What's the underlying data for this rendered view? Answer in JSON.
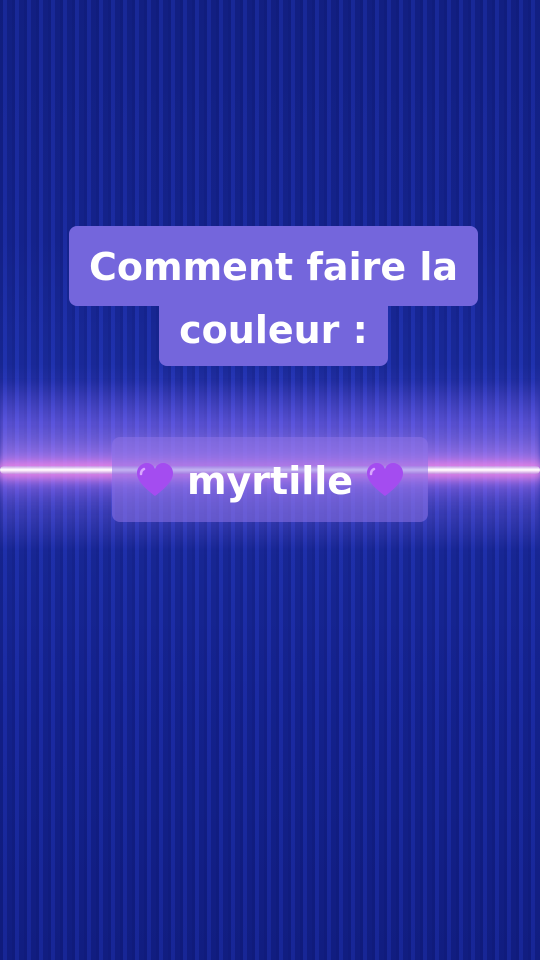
{
  "caption": {
    "line1": "Comment faire la",
    "line2": "couleur :",
    "line3_text": "myrtille",
    "heart_icon": "purple-heart-icon",
    "heart_color": "#a44cf0"
  },
  "colors": {
    "background": "#1a2a9c",
    "caption_box": "#7466dc",
    "glow": "#ff9be8"
  }
}
